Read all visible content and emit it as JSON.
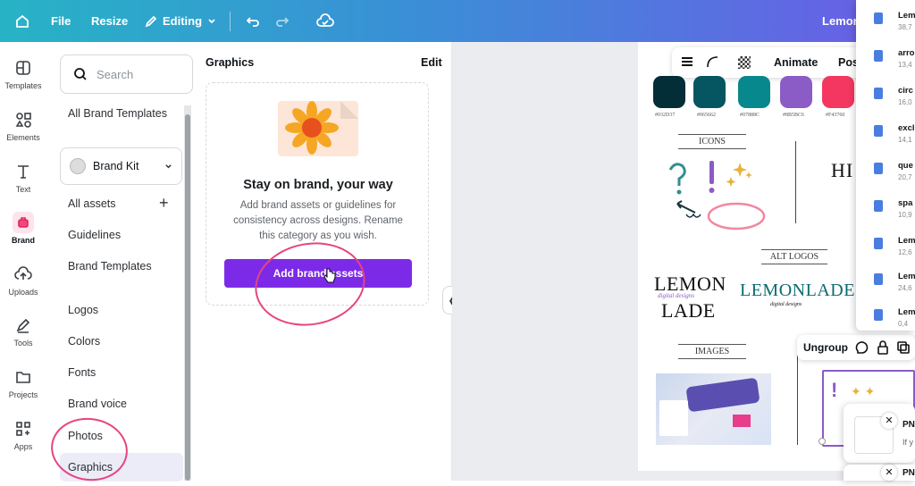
{
  "topbar": {
    "file": "File",
    "resize": "Resize",
    "editing": "Editing",
    "title": "Lemon"
  },
  "rail": [
    {
      "label": "Templates",
      "icon": "templates-icon"
    },
    {
      "label": "Elements",
      "icon": "elements-icon"
    },
    {
      "label": "Text",
      "icon": "text-icon"
    },
    {
      "label": "Brand",
      "icon": "brand-icon"
    },
    {
      "label": "Uploads",
      "icon": "uploads-icon"
    },
    {
      "label": "Tools",
      "icon": "tools-icon"
    },
    {
      "label": "Projects",
      "icon": "projects-icon"
    },
    {
      "label": "Apps",
      "icon": "apps-icon"
    }
  ],
  "panel": {
    "search_placeholder": "Search",
    "all_brand_templates": "All Brand Templates",
    "brand_kit": "Brand Kit",
    "items": [
      "All assets",
      "Guidelines",
      "Brand Templates",
      "Logos",
      "Colors",
      "Fonts",
      "Brand voice",
      "Photos",
      "Graphics"
    ]
  },
  "graphics": {
    "title": "Graphics",
    "edit": "Edit",
    "heading": "Stay on brand, your way",
    "desc": "Add brand assets or guidelines for consistency across designs. Rename this category as you wish.",
    "button": "Add brand assets"
  },
  "canvas": {
    "toolbar_animate": "Animate",
    "toolbar_pos": "Pos",
    "swatches": [
      {
        "hex": "#032D37",
        "color": "#032d37"
      },
      {
        "hex": "#065662",
        "color": "#065662"
      },
      {
        "hex": "#07888C",
        "color": "#07888c"
      },
      {
        "hex": "#8B5BC6",
        "color": "#8b5bc6"
      },
      {
        "hex": "#F43760",
        "color": "#f43760"
      }
    ],
    "icons_label": "ICONS",
    "alt_logos_label": "ALT LOGOS",
    "images_label": "IMAGES",
    "logo1_line1": "LEMON",
    "logo1_sub": "digital designs",
    "logo1_line2": "LADE",
    "logo2": "LEMONLADE",
    "logo2_sub": "digital designs",
    "ungroup": "Ungroup"
  },
  "downloads": [
    {
      "name": "Lem",
      "size": "38,7"
    },
    {
      "name": "arro",
      "size": "13,4"
    },
    {
      "name": "circ",
      "size": "16,0"
    },
    {
      "name": "excl",
      "size": "14,1"
    },
    {
      "name": "que",
      "size": "20,7"
    },
    {
      "name": "spa",
      "size": "10,9"
    },
    {
      "name": "Lem",
      "size": "12,6"
    },
    {
      "name": "Lem",
      "size": "24,6"
    },
    {
      "name": "Lem",
      "size": "0,4"
    }
  ],
  "png_cards": [
    {
      "label": "PN",
      "sub": "If y"
    },
    {
      "label": "PN",
      "sub": ""
    }
  ],
  "colors": {
    "accent": "#7d2ae8",
    "annotation": "#e5457f"
  }
}
